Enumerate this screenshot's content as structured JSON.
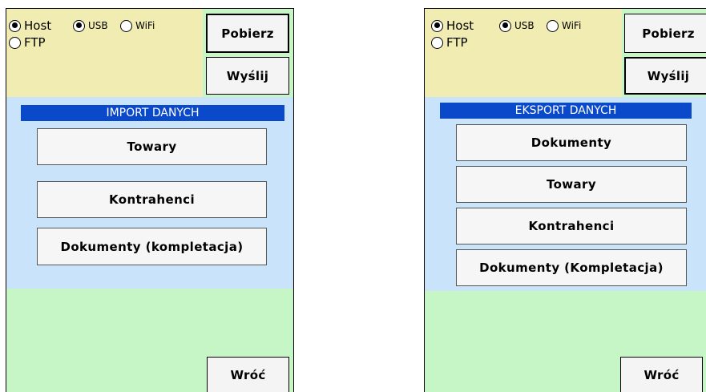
{
  "left_screen": {
    "radios": [
      {
        "label": "Host",
        "checked": true
      },
      {
        "label": "USB",
        "checked": true
      },
      {
        "label": "WiFi",
        "checked": false
      },
      {
        "label": "FTP",
        "checked": false
      }
    ],
    "download_label": "Pobierz",
    "send_label": "Wyślij",
    "header": "IMPORT DANYCH",
    "menu": [
      "Towary",
      "Kontrahenci",
      "Dokumenty (kompletacja)"
    ],
    "back_label": "Wróć"
  },
  "right_screen": {
    "radios": [
      {
        "label": "Host",
        "checked": true
      },
      {
        "label": "USB",
        "checked": true
      },
      {
        "label": "WiFi",
        "checked": false
      },
      {
        "label": "FTP",
        "checked": false
      }
    ],
    "download_label": "Pobierz",
    "send_label": "Wyślij",
    "header": "EKSPORT DANYCH",
    "menu": [
      "Dokumenty",
      "Towary",
      "Kontrahenci",
      "Dokumenty (Kompletacja)"
    ],
    "back_label": "Wróć"
  }
}
